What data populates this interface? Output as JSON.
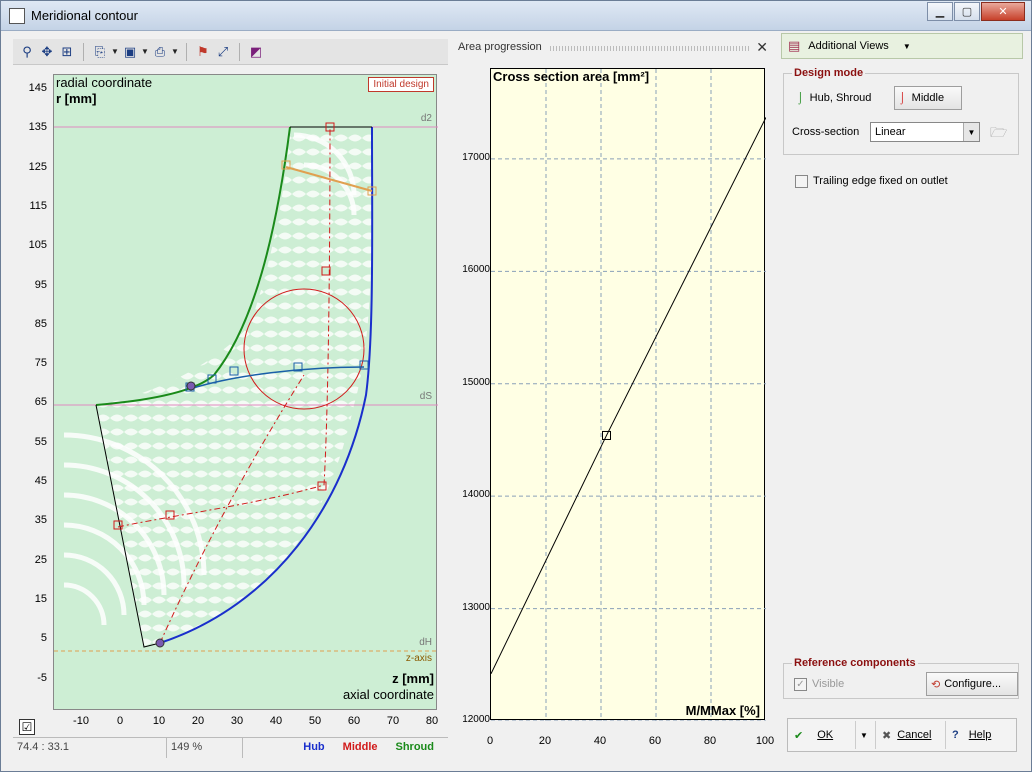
{
  "window": {
    "title": "Meridional contour",
    "min_label": "▁",
    "max_label": "▢",
    "close_label": "✕"
  },
  "toolbar": {
    "icons": [
      "zoom-icon",
      "pan-icon",
      "fit-icon",
      "copy-icon",
      "save-icon",
      "print-icon",
      "flag-icon",
      "resize-icon",
      "palette-icon"
    ]
  },
  "meridional": {
    "ylabel_line1": "radial coordinate",
    "ylabel_line2": "r [mm]",
    "xlabel_line1": "z [mm]",
    "xlabel_line2": "axial coordinate",
    "initial_design": "Initial design",
    "label_d2": "d2",
    "label_dS": "dS",
    "label_dH": "dH",
    "label_zaxis": "z-axis",
    "yticks": [
      "145",
      "135",
      "125",
      "115",
      "105",
      "95",
      "85",
      "75",
      "65",
      "55",
      "45",
      "35",
      "25",
      "15",
      "5",
      "-5"
    ],
    "xticks": [
      "-10",
      "0",
      "10",
      "20",
      "30",
      "40",
      "50",
      "60",
      "70",
      "80"
    ]
  },
  "status": {
    "coords": "74.4 : 33.1",
    "zoom": "149 %",
    "hub": "Hub",
    "middle": "Middle",
    "shroud": "Shroud",
    "hub_color": "#1a2fcc",
    "middle_color": "#d11a1a",
    "shroud_color": "#1a8a1a"
  },
  "area_panel": {
    "header": "Area progression",
    "close": "✕"
  },
  "chart_data": {
    "type": "line",
    "title": "Cross section area [mm²]",
    "xlabel": "M/MMax [%]",
    "ylabel": "",
    "xlim": [
      0,
      100
    ],
    "ylim": [
      12000,
      17800
    ],
    "xticks": [
      0,
      20,
      40,
      60,
      80,
      100
    ],
    "yticks": [
      12000,
      13000,
      14000,
      15000,
      16000,
      17000
    ],
    "grid": true,
    "series": [
      {
        "x": [
          0,
          42,
          100
        ],
        "y": [
          12420,
          14540,
          17370
        ]
      }
    ],
    "markers": [
      {
        "x": 42,
        "y": 14540
      }
    ]
  },
  "right": {
    "additional_views": "Additional Views",
    "design_mode": "Design mode",
    "hub_shroud": "Hub, Shroud",
    "middle": "Middle",
    "cross_section_label": "Cross-section",
    "cross_section_value": "Linear",
    "trailing_edge": "Trailing edge fixed on outlet",
    "reference_components": "Reference components",
    "visible": "Visible",
    "configure": "Configure...",
    "ok": "OK",
    "cancel": "Cancel",
    "help": "Help",
    "help_glyph": "?"
  }
}
